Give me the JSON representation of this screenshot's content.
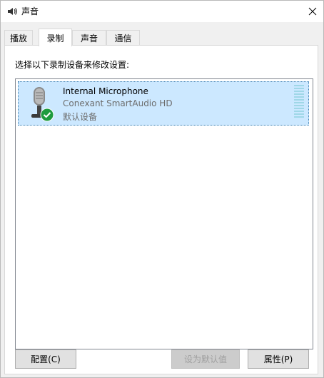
{
  "window": {
    "title": "声音",
    "close_symbol": "✕"
  },
  "tabs": [
    {
      "label": "播放",
      "active": false
    },
    {
      "label": "录制",
      "active": true
    },
    {
      "label": "声音",
      "active": false
    },
    {
      "label": "通信",
      "active": false
    }
  ],
  "panel": {
    "instruction": "选择以下录制设备来修改设置:"
  },
  "devices": [
    {
      "name": "Internal Microphone",
      "driver": "Conexant SmartAudio HD",
      "status": "默认设备",
      "icon": "microphone-icon",
      "badge": "default-check-icon",
      "meter_level": 0
    }
  ],
  "buttons": {
    "configure": "配置(C)",
    "set_default": "设为默认值",
    "properties": "属性(P)"
  },
  "colors": {
    "selection": "#cce8ff",
    "selection_border": "#3c7fb1",
    "check_badge": "#1e9b3e"
  }
}
